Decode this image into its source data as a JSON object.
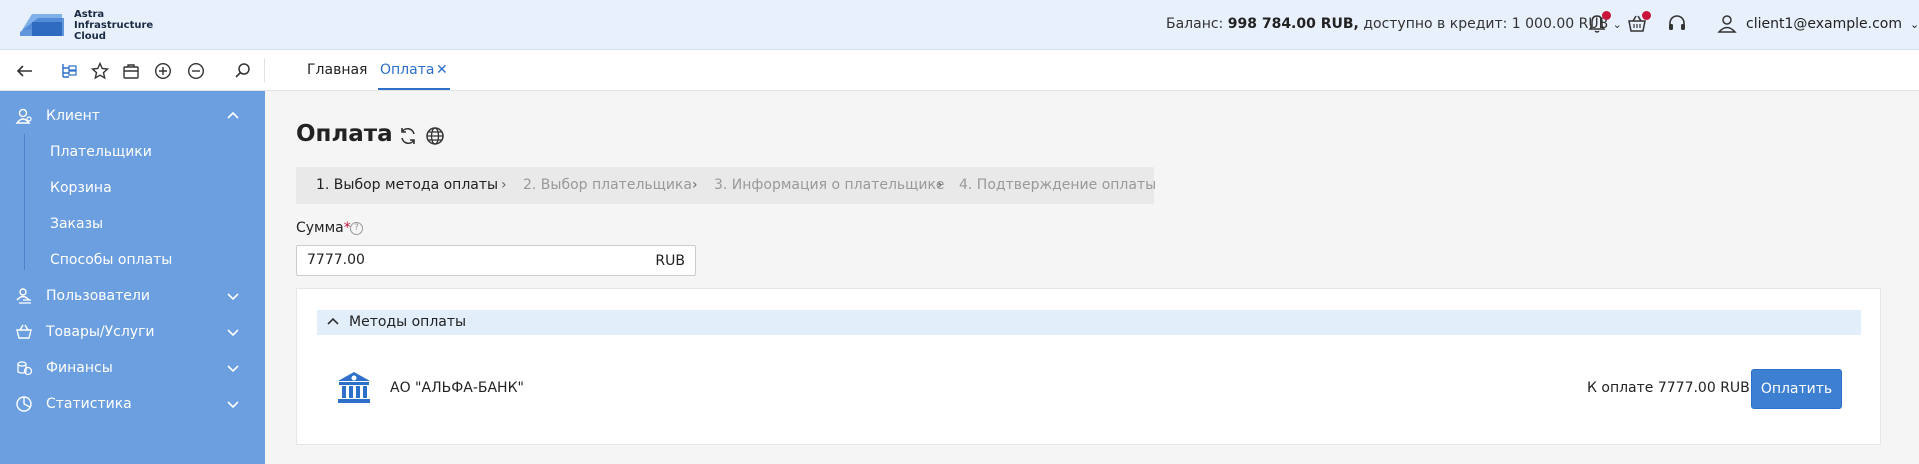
{
  "header": {
    "logo_lines": [
      "Astra",
      "Infrastructure",
      "Cloud"
    ],
    "balance_label": "Баланс:",
    "balance_value": "998 784.00 RUB,",
    "credit_label": "доступно в кредит:",
    "credit_value": "1 000.00 RUB",
    "user_email": "client1@example.com",
    "icons": [
      "bell-icon",
      "basket-icon",
      "headset-icon",
      "user-icon"
    ],
    "notification_color": "#c8143c"
  },
  "toolbar": {
    "icons": [
      "back-icon",
      "tree-icon",
      "star-icon",
      "briefcase-icon",
      "plus-circle-icon",
      "minus-circle-icon",
      "search-icon"
    ],
    "tabs": [
      {
        "label": "Главная"
      },
      {
        "label": "Оплата"
      }
    ],
    "close_glyph": "✕"
  },
  "sidebar": {
    "bg_color": "#6c9fdf",
    "items": [
      {
        "label": "Клиент",
        "icon": "client-icon",
        "expanded": true
      },
      {
        "label": "Пользователи",
        "icon": "users-icon"
      },
      {
        "label": "Товары/Услуги",
        "icon": "basket-icon"
      },
      {
        "label": "Финансы",
        "icon": "coins-icon"
      },
      {
        "label": "Статистика",
        "icon": "pie-chart-icon"
      }
    ],
    "sub_items": [
      {
        "label": "Плательщики"
      },
      {
        "label": "Корзина"
      },
      {
        "label": "Заказы"
      },
      {
        "label": "Способы оплаты"
      }
    ]
  },
  "main": {
    "title": "Оплата",
    "steps": [
      {
        "label": "1. Выбор метода оплаты"
      },
      {
        "label": "2. Выбор плательщика"
      },
      {
        "label": "3. Информация о плательщике"
      },
      {
        "label": "4. Подтверждение оплаты"
      }
    ],
    "step_separator": "›",
    "sum": {
      "label": "Сумма",
      "required_mark": "*",
      "info_glyph": "?",
      "value": "7777.00",
      "currency": "RUB"
    },
    "methods": {
      "header": "Методы оплаты",
      "bank_name": "АО \"АЛЬФА-БАНК\"",
      "amount_text": "К оплате 7777.00 RUB",
      "pay_button": "Оплатить"
    }
  }
}
